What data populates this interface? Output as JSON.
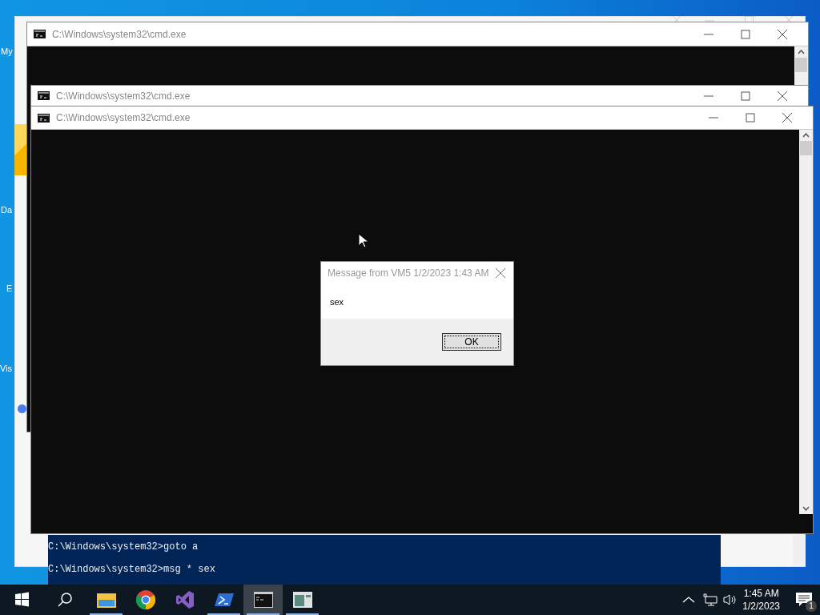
{
  "desktop_icons": [
    {
      "label": "My"
    },
    {
      "label": "Da"
    },
    {
      "label": "E"
    },
    {
      "label": "Vis"
    }
  ],
  "windows": [
    {
      "title": "C:\\Windows\\system32\\cmd.exe"
    },
    {
      "title": "C:\\Windows\\system32\\cmd.exe"
    },
    {
      "title": "C:\\Windows\\system32\\cmd.exe"
    }
  ],
  "console": {
    "lines": [
      "C:\\Windows\\system32>goto a",
      "C:\\Windows\\system32>msg * sex"
    ]
  },
  "dialog": {
    "title": "Message from VM5 1/2/2023 1:43 AM",
    "message": "sex",
    "buttons": [
      "OK"
    ]
  },
  "taskbar": {
    "apps": [
      {
        "kind": "explorer",
        "running": true,
        "selected": false
      },
      {
        "kind": "browser",
        "running": false,
        "selected": false
      },
      {
        "kind": "studio",
        "running": false,
        "selected": false
      },
      {
        "kind": "powershell",
        "running": true,
        "selected": false
      },
      {
        "kind": "cmd",
        "running": true,
        "selected": true
      },
      {
        "kind": "app",
        "running": true,
        "selected": false
      }
    ],
    "clock": {
      "time": "1:45 AM",
      "date": "1/2/2023"
    },
    "notifications": {
      "count": "1"
    }
  }
}
